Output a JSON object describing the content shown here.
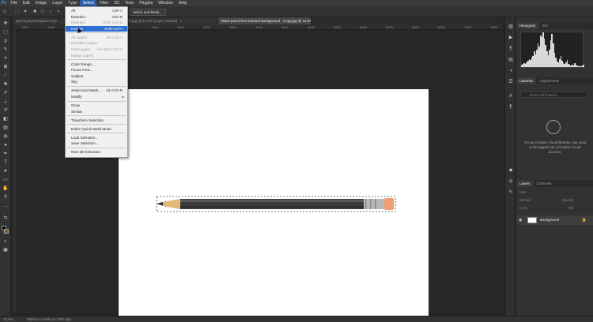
{
  "menubar": {
    "items": [
      "File",
      "Edit",
      "Image",
      "Layer",
      "Type",
      "Select",
      "Filter",
      "3D",
      "View",
      "Plugins",
      "Window",
      "Help"
    ],
    "active": "Select"
  },
  "optbar": {
    "select_mask_label": "Select and Mask..."
  },
  "tabs": [
    {
      "label": "pencil-png-transparent-8.png @...",
      "active": false
    },
    {
      "label": "...",
      "active": false
    },
    {
      "label": "black-pencil-lies-isolated-background.jpg @ 12.5% (Layer Mask/8)",
      "active": false
    },
    {
      "label": "black-pencil-lies-isolated-background - Copy.jpg @ 12.5% (RGB/8)",
      "active": true
    }
  ],
  "ruler_labels": [
    "-1500",
    "-1000",
    "-500",
    "0",
    "500",
    "1000",
    "1500",
    "2000",
    "2500",
    "3000",
    "3500",
    "4000",
    "4500",
    "5000",
    "5500",
    "6000",
    "6500",
    "7000",
    "7500"
  ],
  "select_menu": {
    "groups": [
      [
        {
          "label": "All",
          "shortcut": "Ctrl+A",
          "state": "normal"
        },
        {
          "label": "Deselect",
          "shortcut": "Ctrl+D",
          "state": "normal"
        },
        {
          "label": "Reselect",
          "shortcut": "Shift+Ctrl+D",
          "state": "disabled"
        },
        {
          "label": "Inverse",
          "shortcut": "Shift+Ctrl+I",
          "state": "hover"
        }
      ],
      [
        {
          "label": "All Layers",
          "shortcut": "Alt+Ctrl+A",
          "state": "disabled"
        },
        {
          "label": "Deselect Layers",
          "shortcut": "",
          "state": "disabled"
        },
        {
          "label": "Find Layers",
          "shortcut": "Alt+Shift+Ctrl+F",
          "state": "disabled"
        },
        {
          "label": "Isolate Layers",
          "shortcut": "",
          "state": "disabled"
        }
      ],
      [
        {
          "label": "Color Range...",
          "shortcut": "",
          "state": "normal"
        },
        {
          "label": "Focus Area...",
          "shortcut": "",
          "state": "normal"
        },
        {
          "label": "Subject",
          "shortcut": "",
          "state": "normal"
        },
        {
          "label": "Sky",
          "shortcut": "",
          "state": "normal"
        }
      ],
      [
        {
          "label": "Select and Mask...",
          "shortcut": "Alt+Ctrl+R",
          "state": "normal"
        },
        {
          "label": "Modify",
          "shortcut": "",
          "state": "submenu"
        }
      ],
      [
        {
          "label": "Grow",
          "shortcut": "",
          "state": "normal"
        },
        {
          "label": "Similar",
          "shortcut": "",
          "state": "normal"
        }
      ],
      [
        {
          "label": "Transform Selection",
          "shortcut": "",
          "state": "normal"
        }
      ],
      [
        {
          "label": "Edit in Quick Mask Mode",
          "shortcut": "",
          "state": "normal"
        }
      ],
      [
        {
          "label": "Load Selection...",
          "shortcut": "",
          "state": "normal"
        },
        {
          "label": "Save Selection...",
          "shortcut": "",
          "state": "normal"
        }
      ],
      [
        {
          "label": "New 3D Extrusion",
          "shortcut": "",
          "state": "normal"
        }
      ]
    ]
  },
  "panels": {
    "histogram_tabs": [
      "Histogram",
      "Info"
    ],
    "libraries_tabs": [
      "Libraries",
      "Adjustments"
    ],
    "libraries_search_placeholder": "Search all libraries",
    "libraries_message": "To use Creative Cloud libraries, you need to be logged into a Creative Cloud account.",
    "layers_tabs": [
      "Layers",
      "Channels"
    ],
    "layers_kind": "Kind",
    "layers_blend": "Normal",
    "layers_opacity_label": "Opacity:",
    "layers_lock_label": "Lock:",
    "layers_fill_label": "Fill:",
    "layer_name": "Background"
  },
  "status": {
    "zoom": "12.5%",
    "doc_size": "8000 px x 5000 px (300 ppi)"
  },
  "colors": {
    "accent": "#2c6fd1",
    "menu_active": "#2c5fa8",
    "pencil_body": "#3c3c3c",
    "eraser": "#f0a070",
    "wood": "#e3b97a"
  }
}
